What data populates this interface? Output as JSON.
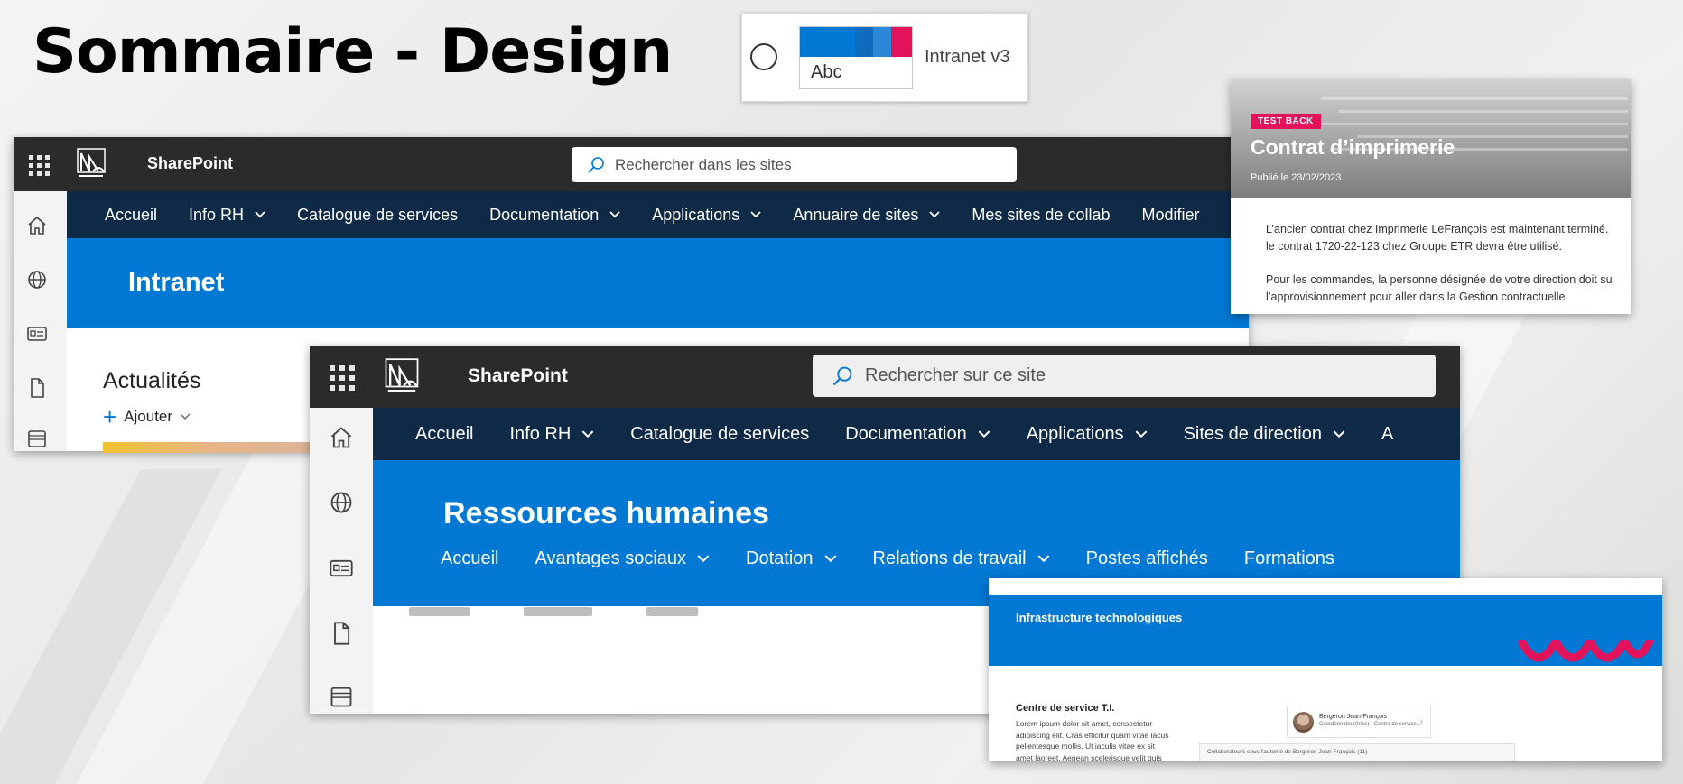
{
  "slide": {
    "title": "Sommaire - Design"
  },
  "theme_picker": {
    "preview_text": "Abc",
    "name": "Intranet v3",
    "colors": [
      "#0078d4",
      "#0f6cbd",
      "#2b88d8",
      "#62a7e6",
      "#e3135b"
    ]
  },
  "intranet_screen": {
    "brand": "SharePoint",
    "search_placeholder": "Rechercher dans les sites",
    "nav": [
      {
        "label": "Accueil",
        "dropdown": false
      },
      {
        "label": "Info RH",
        "dropdown": true
      },
      {
        "label": "Catalogue de services",
        "dropdown": false
      },
      {
        "label": "Documentation",
        "dropdown": true
      },
      {
        "label": "Applications",
        "dropdown": true
      },
      {
        "label": "Annuaire de sites",
        "dropdown": true
      },
      {
        "label": "Mes sites de collab",
        "dropdown": false
      },
      {
        "label": "Modifier",
        "dropdown": false
      }
    ],
    "site_title": "Intranet",
    "news_section": {
      "title": "Actualités",
      "add_label": "Ajouter"
    }
  },
  "rh_screen": {
    "brand": "SharePoint",
    "search_placeholder": "Rechercher sur ce site",
    "nav": [
      {
        "label": "Accueil",
        "dropdown": false
      },
      {
        "label": "Info RH",
        "dropdown": true
      },
      {
        "label": "Catalogue de services",
        "dropdown": false
      },
      {
        "label": "Documentation",
        "dropdown": true
      },
      {
        "label": "Applications",
        "dropdown": true
      },
      {
        "label": "Sites de direction",
        "dropdown": true
      },
      {
        "label": "A",
        "dropdown": false
      }
    ],
    "site_title": "Ressources humaines",
    "site_nav": [
      {
        "label": "Accueil",
        "dropdown": false
      },
      {
        "label": "Avantages sociaux",
        "dropdown": true
      },
      {
        "label": "Dotation",
        "dropdown": true
      },
      {
        "label": "Relations de travail",
        "dropdown": true
      },
      {
        "label": "Postes affichés",
        "dropdown": false
      },
      {
        "label": "Formations",
        "dropdown": false
      }
    ]
  },
  "news_card": {
    "tag": "TEST BACK",
    "title": "Contrat d’imprimerie",
    "date": "Publié le 23/02/2023",
    "paragraphs": [
      "L’ancien contrat chez Imprimerie LeFrançois est maintenant terminé.",
      "le contrat 1720-22-123 chez Groupe ETR devra être utilisé.",
      "Pour les commandes, la personne désignée de votre direction doit su",
      "l’approvisionnement pour aller dans la Gestion contractuelle."
    ]
  },
  "infra_screen": {
    "site_title": "Infrastructure technologiques",
    "section_title": "Centre de service T.I.",
    "section_text": "Lorem ipsum dolor sit amet, consectetur adipiscing elit. Cras efficitur quam vitae lacus pellentesque mollis. Ut iaculis vitae ex sit amet laoreet. Aenean scelerisque velit quis lobortis",
    "person_name": "Bergeron Jean-François",
    "person_role": "Coordonnateur(trice) - Centre de service...",
    "collab_label": "Collaborateurs sous l'autorité de Bergeron Jean-François (11)"
  }
}
